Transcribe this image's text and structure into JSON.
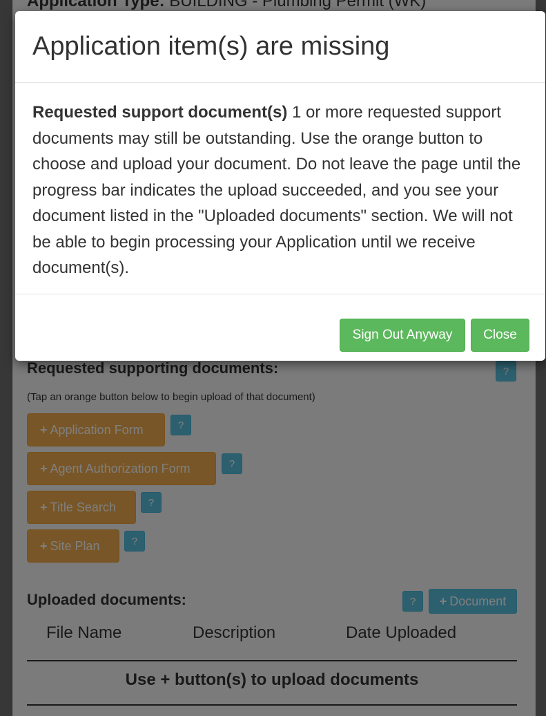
{
  "page": {
    "application_type_label": "Application Type:",
    "application_type_value": "BUILDING - Plumbing Permit (WK)",
    "requested_section": {
      "title": "Requested supporting documents:",
      "hint": "(Tap an orange button below to begin upload of that document)",
      "help_icon": "question-mark",
      "buttons": [
        {
          "label": "Application Form"
        },
        {
          "label": "Agent Authorization Form"
        },
        {
          "label": "Title Search"
        },
        {
          "label": "Site Plan"
        }
      ],
      "help_label": "?"
    },
    "uploaded_section": {
      "title": "Uploaded documents:",
      "help_label": "?",
      "add_document_label": "Document",
      "columns": [
        "File Name",
        "Description",
        "Date Uploaded"
      ],
      "empty_message": "Use + button(s) to upload documents"
    },
    "plus_glyph": "+"
  },
  "modal": {
    "title": "Application item(s) are missing",
    "body_bold": "Requested support document(s)",
    "body_text": " 1 or more requested support documents may still be outstanding. Use the orange button to choose and upload your document. Do not leave the page until the progress bar indicates the upload succeeded, and you see your document listed in the \"Uploaded documents\" section. We will not be able to begin processing your Application until we receive document(s).",
    "sign_out_label": "Sign Out Anyway",
    "close_label": "Close"
  },
  "colors": {
    "orange_button": "#f0ad4e",
    "info_button": "#5bc0de",
    "success_button": "#5cb85c"
  }
}
